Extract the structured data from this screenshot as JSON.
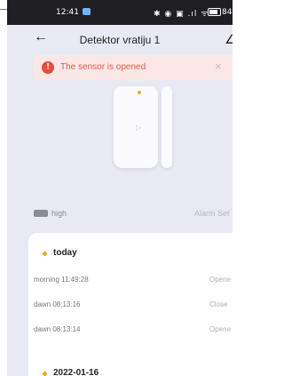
{
  "status_bar": {
    "time": "12:41",
    "icons": "✱ ◉ ▣ .ıl ᯤ",
    "battery_percent": "84"
  },
  "header": {
    "title": "Detektor vratiju 1",
    "back_icon": "←",
    "edit_icon": "∠"
  },
  "alert": {
    "text": "The sensor is opened",
    "icon": "!",
    "close": "×"
  },
  "device_image": {
    "led_color": "#f5a623"
  },
  "info": {
    "battery_label": "high",
    "alarm_settings": "Alarm Set"
  },
  "history": {
    "groups": [
      {
        "date": "today",
        "entries": [
          {
            "time": "morning  11:49:28",
            "status": "Opene"
          },
          {
            "time": "dawn  08:13:16",
            "status": "Close"
          },
          {
            "time": "dawn  08:13:14",
            "status": "Opene"
          }
        ]
      },
      {
        "date": "2022-01-16",
        "entries": []
      }
    ]
  },
  "colors": {
    "accent": "#f5a623",
    "alert_red": "#e74c3c",
    "alert_bg": "#fbe8e6",
    "page_bg": "#e9e9f3"
  }
}
